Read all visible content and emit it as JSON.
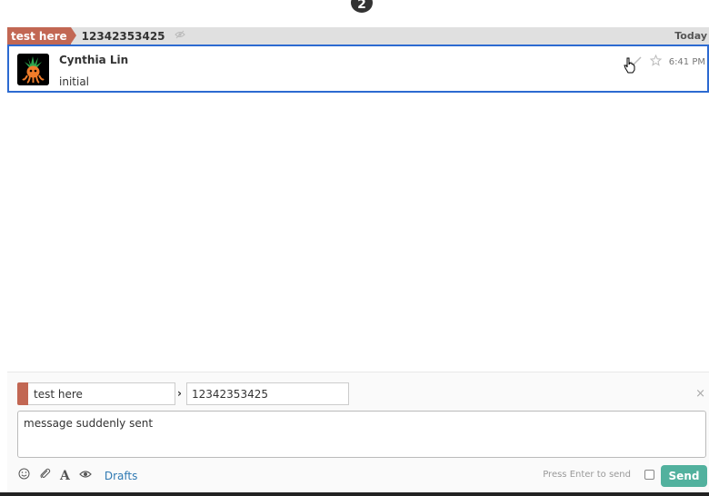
{
  "top_badge": {
    "label": "2"
  },
  "recipient": {
    "stream": "test here",
    "topic": "12342353425",
    "date": "Today",
    "stream_color": "#c26753"
  },
  "message": {
    "sender": "Cynthia Lin",
    "content": "initial",
    "time": "6:41 PM",
    "icons": [
      "edit-icon",
      "star-icon"
    ]
  },
  "compose": {
    "stream_value": "test here",
    "topic_value": "12342353425",
    "arrow": "›",
    "message_value": "message suddenly sent",
    "drafts_label": "Drafts",
    "enter_label": "Press Enter to send",
    "send_label": "Send",
    "close_label": "×",
    "tools": [
      "emoji-icon",
      "attachment-icon",
      "format-icon",
      "preview-icon"
    ],
    "send_color": "#52b19e"
  },
  "colors": {
    "selected_border": "#2c6ad1",
    "recipient_bar_bg": "#e0e0e0"
  }
}
